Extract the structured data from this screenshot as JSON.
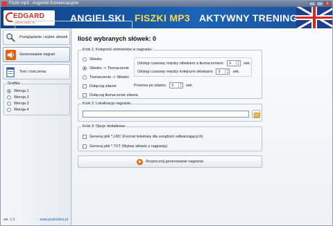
{
  "window": {
    "title": "Fiszki mp3 - Angielski Konwersacyjne"
  },
  "banner": {
    "logo_name": "EDGARD",
    "logo_sub": "JĘZYKI OBCE .PL",
    "part1": "ANGIELSKI",
    "part2": "FISZKI MP3",
    "part3": "AKTYWNY TRENING"
  },
  "sidebar": {
    "items": [
      {
        "label": "Przeglądanie i wybór słówek",
        "icon": "magnifier-icon"
      },
      {
        "label": "Generowanie nagrań",
        "icon": "speaker-icon"
      },
      {
        "label": "Test i ćwiczenia",
        "icon": "test-icon"
      }
    ],
    "grafika": {
      "legend": "Grafika",
      "options": [
        "Wersja 1",
        "Wersja 2",
        "Wersja 3",
        "Wersja 4"
      ],
      "selected": 0
    },
    "version": "ver. 1.1",
    "website": "www.jezykiobce.pl"
  },
  "main": {
    "title": "Ilość wybranych słówek: 0",
    "step1": {
      "legend": "Krok 1: Kolejność elementów w nagraniu:",
      "order_options": [
        "Słówko",
        "Słówko -> Tłumaczenie",
        "Tłumaczenie -> Słówko"
      ],
      "order_selected": 1,
      "include_sentence": "Dołączaj zdanie",
      "include_translation": "Dołączaj tłumaczenie zdania",
      "gap_word_label": "Odstęp czasowy między słówkiem a tłumaczeniem:",
      "gap_word_value": "3",
      "gap_next_label": "Odstęp czasowy między kolejnymi słówkami:",
      "gap_next_value": "3",
      "pause_label": "Przerwa po zdaniu:",
      "pause_value": "3",
      "unit": "sek."
    },
    "step2": {
      "legend": "Krok 2: Lokalizacja nagrania",
      "path": ""
    },
    "step3": {
      "legend": "Krok 3: Opcje dodatkowe",
      "lrc_label": "Generuj plik *.LRC (Format tekstowy dla urządzeń odtwarzających)",
      "txt_label": "Generuj plik *.TXT (Wykaz słówek z nagrania)"
    },
    "generate_label": "Rozpocznij generowanie nagrania"
  }
}
